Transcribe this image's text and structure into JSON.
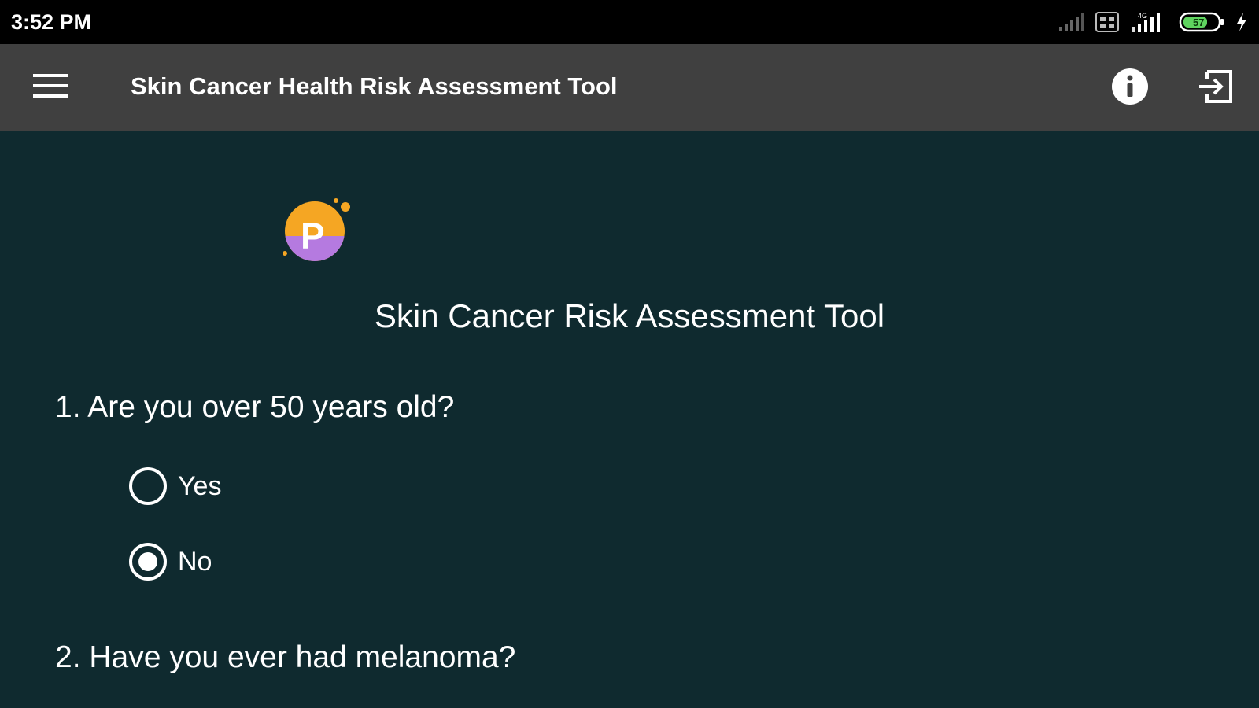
{
  "status_bar": {
    "time": "3:52 PM",
    "battery_level": "57",
    "network_label": "4G",
    "icons": [
      "signal-weak-icon",
      "hd-icon",
      "signal-strong-icon",
      "battery-icon",
      "charging-icon"
    ]
  },
  "app_bar": {
    "title": "Skin Cancer Health Risk Assessment Tool",
    "icons": [
      "menu-icon",
      "info-icon",
      "exit-icon"
    ]
  },
  "content": {
    "logo_letter": "P",
    "form_title": "Skin Cancer Risk Assessment Tool",
    "questions": [
      {
        "text": "1. Are you over 50 years old?",
        "options": [
          {
            "label": "Yes",
            "selected": false
          },
          {
            "label": "No",
            "selected": true
          }
        ]
      },
      {
        "text": "2. Have you ever had melanoma?"
      }
    ]
  },
  "colors": {
    "background": "#0f2a2f",
    "app_bar": "#404040",
    "status_bar": "#000000",
    "text": "#ffffff",
    "logo_orange": "#f5a623",
    "logo_purple": "#b57ae0"
  }
}
